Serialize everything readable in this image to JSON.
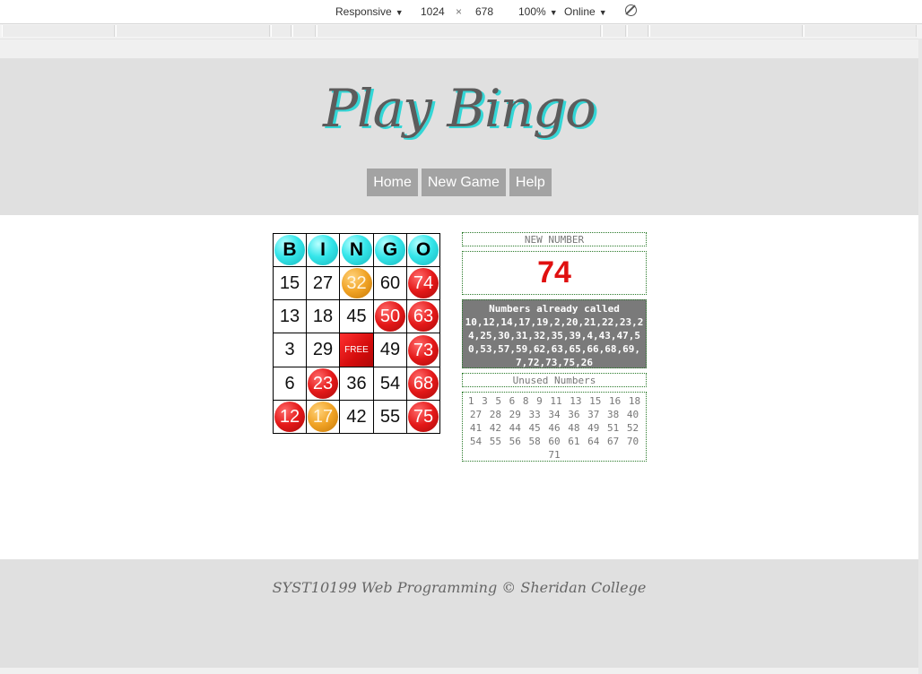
{
  "devtools": {
    "device": "Responsive",
    "width": "1024",
    "times": "×",
    "height": "678",
    "zoom": "100%",
    "network": "Online",
    "rotate_icon": "rotate-icon"
  },
  "site": {
    "title": "Play Bingo",
    "nav": [
      "Home",
      "New Game",
      "Help"
    ],
    "footer": "SYST10199 Web Programming © Sheridan College"
  },
  "card": {
    "header": [
      "B",
      "I",
      "N",
      "G",
      "O"
    ],
    "rows": [
      [
        {
          "v": "15",
          "s": ""
        },
        {
          "v": "27",
          "s": ""
        },
        {
          "v": "32",
          "s": "orange"
        },
        {
          "v": "60",
          "s": ""
        },
        {
          "v": "74",
          "s": "red"
        }
      ],
      [
        {
          "v": "13",
          "s": ""
        },
        {
          "v": "18",
          "s": ""
        },
        {
          "v": "45",
          "s": ""
        },
        {
          "v": "50",
          "s": "red"
        },
        {
          "v": "63",
          "s": "red"
        }
      ],
      [
        {
          "v": "3",
          "s": ""
        },
        {
          "v": "29",
          "s": ""
        },
        {
          "v": "FREE",
          "s": "free"
        },
        {
          "v": "49",
          "s": ""
        },
        {
          "v": "73",
          "s": "red"
        }
      ],
      [
        {
          "v": "6",
          "s": ""
        },
        {
          "v": "23",
          "s": "red"
        },
        {
          "v": "36",
          "s": ""
        },
        {
          "v": "54",
          "s": ""
        },
        {
          "v": "68",
          "s": "red"
        }
      ],
      [
        {
          "v": "12",
          "s": "red"
        },
        {
          "v": "17",
          "s": "orange"
        },
        {
          "v": "42",
          "s": ""
        },
        {
          "v": "55",
          "s": ""
        },
        {
          "v": "75",
          "s": "red"
        }
      ]
    ]
  },
  "panel": {
    "new_label": "NEW NUMBER",
    "new_number": "74",
    "called_label": "Numbers already called",
    "called_list": "10,12,14,17,19,2,20,21,22,23,24,25,30,31,32,35,39,4,43,47,50,53,57,59,62,63,65,66,68,69,7,72,73,75,26",
    "unused_label": "Unused Numbers",
    "unused_list": "1 3 5 6 8 9 11 13 15 16 18 27 28 29 33 34 36 37 38 40 41 42 44 45 46 48 49 51 52 54 55 56 58 60 61 64 67 70 71"
  },
  "colors": {
    "header_bg": "#e0e0e0",
    "title_shadow": "#33d6d6",
    "nav_bg": "#a3a3a3",
    "called_ball": "#e41818",
    "marked_ball": "#f0a224",
    "letter_ball": "#35e6ea",
    "new_number": "#e01010"
  }
}
